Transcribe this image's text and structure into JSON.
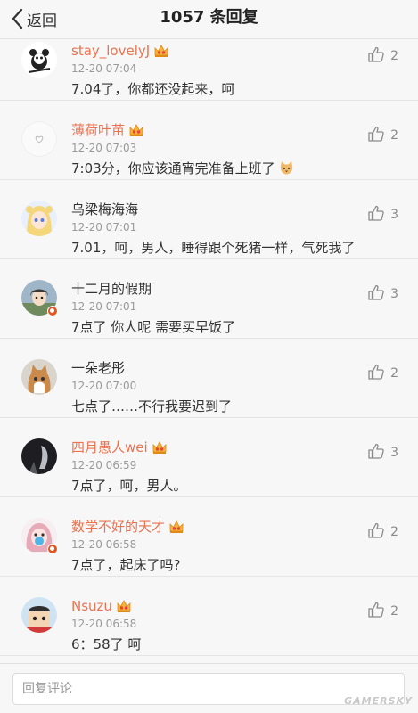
{
  "header": {
    "back_label": "返回",
    "title": "1057 条回复"
  },
  "comments": [
    {
      "username": "stay_lovelyJ",
      "vip": true,
      "time": "12-20 07:04",
      "content": "7.04了，你都还没起来，呵",
      "likes": "2",
      "badge": false,
      "avatar": "panda-avatar"
    },
    {
      "username": "薄荷叶苗",
      "vip": true,
      "time": "12-20 07:03",
      "content": "7:03分，你应该通宵完准备上班了",
      "emoji": "cat-face",
      "likes": "2",
      "badge": false,
      "avatar": "heart-avatar"
    },
    {
      "username": "乌梁梅海海",
      "vip": false,
      "time": "12-20 07:01",
      "content": "7.01，呵，男人，睡得跟个死猪一样，气死我了",
      "likes": "3",
      "badge": false,
      "avatar": "anime-girl-avatar"
    },
    {
      "username": "十二月的假期",
      "vip": false,
      "time": "12-20 07:01",
      "content": "7点了 你人呢 需要买早饭了",
      "likes": "3",
      "badge": true,
      "avatar": "anime-boy-avatar"
    },
    {
      "username": "一朵老彤",
      "vip": false,
      "time": "12-20 07:00",
      "content": "七点了……不行我要迟到了",
      "likes": "2",
      "badge": false,
      "avatar": "cat-avatar"
    },
    {
      "username": "四月愚人wei",
      "vip": true,
      "time": "12-20 06:59",
      "content": "7点了，呵，男人。",
      "likes": "3",
      "badge": false,
      "avatar": "dark-avatar"
    },
    {
      "username": "数学不好的天才",
      "vip": true,
      "time": "12-20 06:58",
      "content": "7点了，起床了吗?",
      "likes": "2",
      "badge": true,
      "avatar": "pink-girl-avatar"
    },
    {
      "username": "Nsuzu",
      "vip": true,
      "time": "12-20 06:58",
      "content": "6：58了 呵",
      "likes": "2",
      "badge": false,
      "avatar": "cartoon-boy-avatar"
    }
  ],
  "footer": {
    "input_placeholder": "回复评论",
    "watermark": "GAMERSKY"
  },
  "colors": {
    "vip_name": "#eb7350",
    "background": "#f7f7f7",
    "separator": "#e4e4e4"
  }
}
